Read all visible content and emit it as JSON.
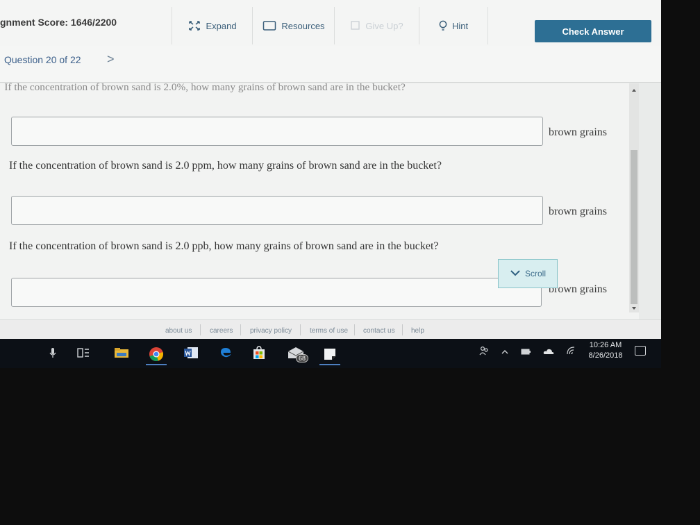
{
  "header": {
    "score_text": "gnment Score: 1646/2200",
    "expand_label": "Expand",
    "resources_label": "Resources",
    "giveup_label": "Give Up?",
    "hint_label": "Hint",
    "check_label": "Check Answer"
  },
  "question_nav": {
    "label": "Question 20 of 22",
    "next_symbol": ">"
  },
  "content": {
    "cut_off_text": "If the concentration of brown sand is 2.0%, how many grains of brown sand are in the bucket?",
    "answer1": {
      "value": "",
      "unit": "brown grains"
    },
    "question2": "If the concentration of brown sand is 2.0 ppm, how many grains of brown sand are in the bucket?",
    "answer2": {
      "value": "",
      "unit": "brown grains"
    },
    "question3": "If the concentration of brown sand is 2.0 ppb, how many grains of brown sand are in the bucket?",
    "answer3": {
      "value": "",
      "unit": "brown grains"
    },
    "scroll_label": "Scroll"
  },
  "footer": {
    "links": [
      "about us",
      "careers",
      "privacy policy",
      "terms of use",
      "contact us",
      "help"
    ]
  },
  "taskbar": {
    "mail_badge": "68",
    "time": "10:26 AM",
    "date": "8/26/2018"
  },
  "icons": {
    "expand": "expand-icon",
    "resources": "folder-icon",
    "giveup": "flag-icon",
    "hint": "lightbulb-icon",
    "scroll": "chevron-down-icon"
  },
  "colors": {
    "accent": "#2d6f94",
    "link": "#3b5f8a",
    "scroll_bg": "#d8eef0"
  }
}
